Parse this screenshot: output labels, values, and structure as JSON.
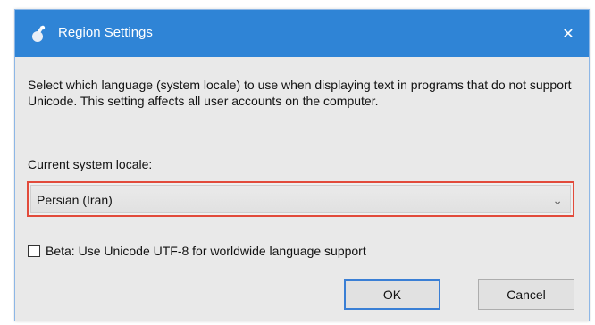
{
  "window": {
    "title": "Region Settings",
    "close_glyph": "✕",
    "icon": "region-settings-icon"
  },
  "dialog": {
    "description": "Select which language (system locale) to use when displaying text in programs that do not support Unicode. This setting affects all user accounts on the computer.",
    "locale_label": "Current system locale:",
    "locale_value": "Persian (Iran)",
    "dropdown_glyph": "⌄",
    "beta_checkbox_label": "Beta: Use Unicode UTF-8 for worldwide language support",
    "beta_checked": false,
    "ok_label": "OK",
    "cancel_label": "Cancel"
  },
  "colors": {
    "titlebar": "#2f84d6",
    "highlight": "#e24b3b",
    "ok_focus": "#3a7fd5"
  }
}
